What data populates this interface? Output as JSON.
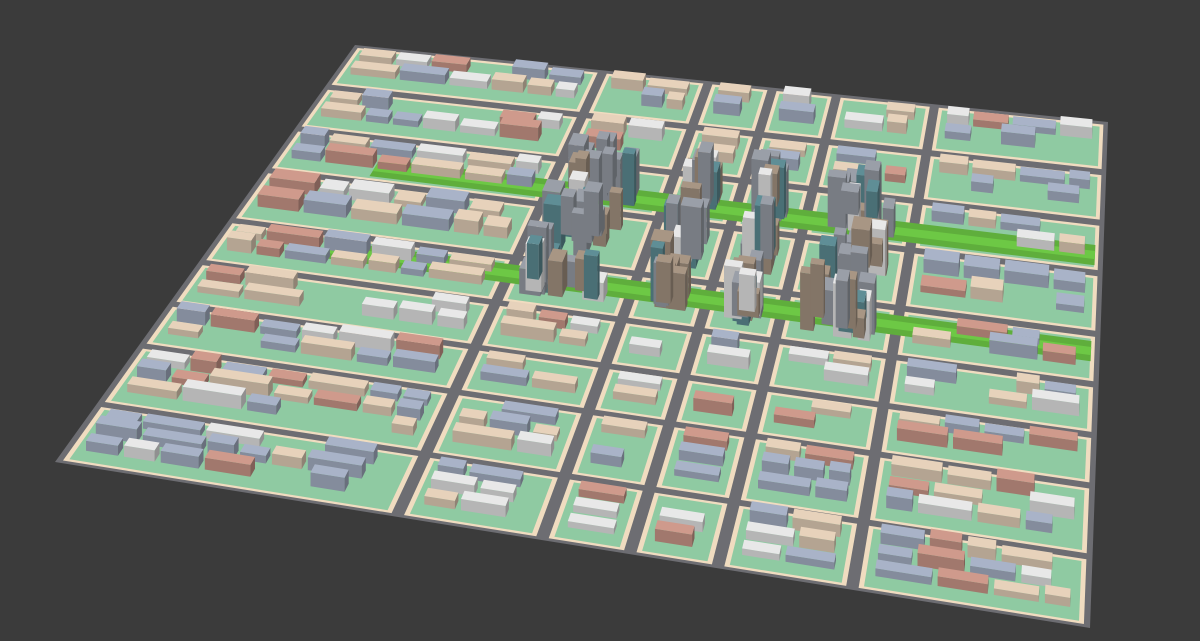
{
  "scene": {
    "subject": "aerial-3d-city-block-model",
    "background_color": "#3b3b3b",
    "ground_color": "#8fcaa2",
    "road_color": "#6d6d72",
    "curb_color": "#f0dcc0",
    "greenbelt_color": "#5fae3c",
    "building_palette": {
      "blue_gray": "#a9b3c8",
      "beige": "#e7d2bb",
      "pink": "#cf9a8c",
      "white": "#e8e8e8",
      "tower_gray": "#9a9fa8",
      "tower_brown": "#a89684",
      "tower_teal": "#5f8e96"
    },
    "grid": {
      "columns": 6,
      "rows": 7
    }
  }
}
